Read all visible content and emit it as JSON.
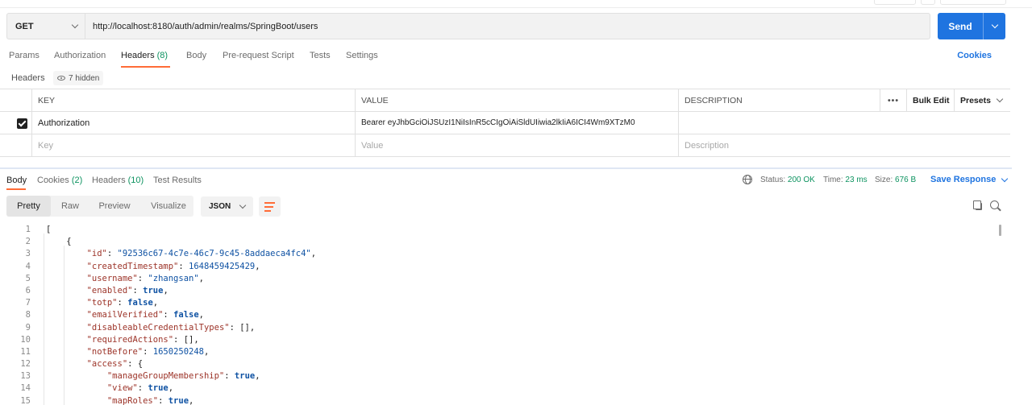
{
  "request": {
    "method": "GET",
    "url": "http://localhost:8180/auth/admin/realms/SpringBoot/users",
    "send_label": "Send"
  },
  "request_tabs": [
    {
      "label": "Params",
      "count": ""
    },
    {
      "label": "Authorization",
      "count": ""
    },
    {
      "label": "Headers",
      "count": "(8)"
    },
    {
      "label": "Body",
      "count": ""
    },
    {
      "label": "Pre-request Script",
      "count": ""
    },
    {
      "label": "Tests",
      "count": ""
    },
    {
      "label": "Settings",
      "count": ""
    }
  ],
  "active_request_tab": "Headers",
  "cookies_link": "Cookies",
  "headers_section": {
    "title": "Headers",
    "hidden_label": "7 hidden",
    "columns": {
      "key": "KEY",
      "value": "VALUE",
      "description": "DESCRIPTION"
    },
    "more_label": "•••",
    "bulk_edit": "Bulk Edit",
    "presets": "Presets",
    "rows": [
      {
        "checked": true,
        "key": "Authorization",
        "value": "Bearer eyJhbGciOiJSUzI1NiIsInR5cCIgOiAiSldUIiwia2lkIiA6ICI4Wm9XTzM0",
        "description": ""
      }
    ],
    "placeholders": {
      "key": "Key",
      "value": "Value",
      "description": "Description"
    }
  },
  "response_tabs": [
    {
      "label": "Body",
      "count": ""
    },
    {
      "label": "Cookies",
      "count": "(2)"
    },
    {
      "label": "Headers",
      "count": "(10)"
    },
    {
      "label": "Test Results",
      "count": ""
    }
  ],
  "active_response_tab": "Body",
  "response_meta": {
    "status_label": "Status:",
    "status": "200 OK",
    "time_label": "Time:",
    "time": "23 ms",
    "size_label": "Size:",
    "size": "676 B",
    "save_label": "Save Response"
  },
  "format_tabs": [
    "Pretty",
    "Raw",
    "Preview",
    "Visualize"
  ],
  "active_format": "Pretty",
  "format_select": "JSON",
  "icons": {
    "method_dropdown": "chevron-down-icon",
    "send_dropdown": "chevron-down-icon",
    "hidden_toggle": "eye-icon",
    "network": "globe-icon",
    "wrap": "wrap-lines-icon",
    "copy": "copy-icon",
    "search": "search-icon"
  },
  "colors": {
    "accent": "#1f74e0",
    "tab_indicator": "#ff6c37",
    "count_green": "#0d9360",
    "json_key": "#9c3328",
    "json_value": "#0f52a3"
  },
  "code": {
    "line_numbers": [
      "1",
      "2",
      "3",
      "4",
      "5",
      "6",
      "7",
      "8",
      "9",
      "10",
      "11",
      "12",
      "13",
      "14",
      "15"
    ],
    "lines": [
      [
        {
          "t": "p",
          "v": "["
        }
      ],
      [
        {
          "t": "p",
          "v": "    {"
        }
      ],
      [
        {
          "t": "p",
          "v": "        "
        },
        {
          "t": "k",
          "v": "\"id\""
        },
        {
          "t": "p",
          "v": ": "
        },
        {
          "t": "s",
          "v": "\"92536c67-4c7e-46c7-9c45-8addaeca4fc4\""
        },
        {
          "t": "p",
          "v": ","
        }
      ],
      [
        {
          "t": "p",
          "v": "        "
        },
        {
          "t": "k",
          "v": "\"createdTimestamp\""
        },
        {
          "t": "p",
          "v": ": "
        },
        {
          "t": "n",
          "v": "1648459425429"
        },
        {
          "t": "p",
          "v": ","
        }
      ],
      [
        {
          "t": "p",
          "v": "        "
        },
        {
          "t": "k",
          "v": "\"username\""
        },
        {
          "t": "p",
          "v": ": "
        },
        {
          "t": "s",
          "v": "\"zhangsan\""
        },
        {
          "t": "p",
          "v": ","
        }
      ],
      [
        {
          "t": "p",
          "v": "        "
        },
        {
          "t": "k",
          "v": "\"enabled\""
        },
        {
          "t": "p",
          "v": ": "
        },
        {
          "t": "b",
          "v": "true"
        },
        {
          "t": "p",
          "v": ","
        }
      ],
      [
        {
          "t": "p",
          "v": "        "
        },
        {
          "t": "k",
          "v": "\"totp\""
        },
        {
          "t": "p",
          "v": ": "
        },
        {
          "t": "b",
          "v": "false"
        },
        {
          "t": "p",
          "v": ","
        }
      ],
      [
        {
          "t": "p",
          "v": "        "
        },
        {
          "t": "k",
          "v": "\"emailVerified\""
        },
        {
          "t": "p",
          "v": ": "
        },
        {
          "t": "b",
          "v": "false"
        },
        {
          "t": "p",
          "v": ","
        }
      ],
      [
        {
          "t": "p",
          "v": "        "
        },
        {
          "t": "k",
          "v": "\"disableableCredentialTypes\""
        },
        {
          "t": "p",
          "v": ": [],"
        }
      ],
      [
        {
          "t": "p",
          "v": "        "
        },
        {
          "t": "k",
          "v": "\"requiredActions\""
        },
        {
          "t": "p",
          "v": ": [],"
        }
      ],
      [
        {
          "t": "p",
          "v": "        "
        },
        {
          "t": "k",
          "v": "\"notBefore\""
        },
        {
          "t": "p",
          "v": ": "
        },
        {
          "t": "n",
          "v": "1650250248"
        },
        {
          "t": "p",
          "v": ","
        }
      ],
      [
        {
          "t": "p",
          "v": "        "
        },
        {
          "t": "k",
          "v": "\"access\""
        },
        {
          "t": "p",
          "v": ": {"
        }
      ],
      [
        {
          "t": "p",
          "v": "            "
        },
        {
          "t": "k",
          "v": "\"manageGroupMembership\""
        },
        {
          "t": "p",
          "v": ": "
        },
        {
          "t": "b",
          "v": "true"
        },
        {
          "t": "p",
          "v": ","
        }
      ],
      [
        {
          "t": "p",
          "v": "            "
        },
        {
          "t": "k",
          "v": "\"view\""
        },
        {
          "t": "p",
          "v": ": "
        },
        {
          "t": "b",
          "v": "true"
        },
        {
          "t": "p",
          "v": ","
        }
      ],
      [
        {
          "t": "p",
          "v": "            "
        },
        {
          "t": "k",
          "v": "\"mapRoles\""
        },
        {
          "t": "p",
          "v": ": "
        },
        {
          "t": "b",
          "v": "true"
        },
        {
          "t": "p",
          "v": ","
        }
      ]
    ]
  }
}
